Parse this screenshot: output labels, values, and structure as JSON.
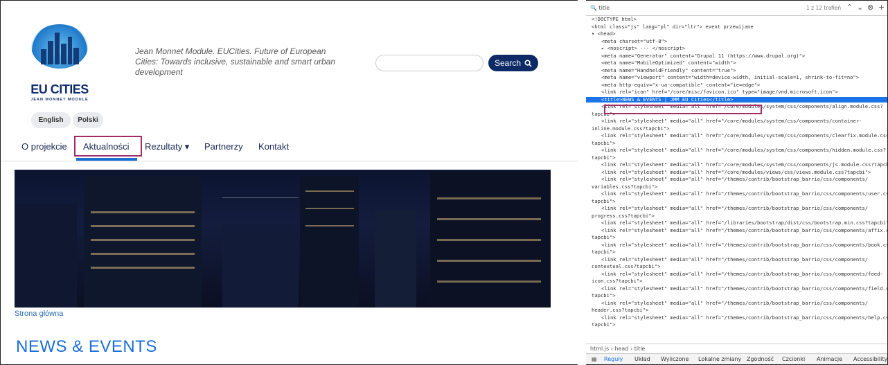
{
  "site": {
    "logo_title": "EU CITIES",
    "logo_subtitle": "JEAN MONNET MODULE",
    "tagline": "Jean Monnet Module. EUCities. Future of European Cities: Towards inclusive, sustainable and smart urban development",
    "search_placeholder": "",
    "search_button": "Search",
    "languages": [
      "English",
      "Polski"
    ],
    "nav": [
      "O projekcie",
      "Aktualności",
      "Rezultaty ▾",
      "Partnerzy",
      "Kontakt"
    ],
    "active_nav": "Aktualności",
    "breadcrumb": "Strona główna",
    "page_title": "NEWS & EVENTS",
    "colors": {
      "brand": "#0d2a66",
      "accent": "#1b6fd8",
      "highlight_box": "#a02a6a"
    }
  },
  "devtools": {
    "search_query": "title",
    "match_count": "1 z 12 trafień",
    "lines": [
      "<!DOCTYPE html>",
      "<html class=\"js\" lang=\"pl\" dir=\"ltr\"> event przewijane",
      "▾ <head>",
      "<meta charset=\"utf-8\">",
      "▸ <noscript> ··· </noscript>",
      "<meta name=\"Generator\" content=\"Drupal 11 (https://www.drupal.org)\">",
      "<meta name=\"MobileOptimized\" content=\"width\">",
      "<meta name=\"HandheldFriendly\" content=\"true\">",
      "<meta name=\"viewport\" content=\"width=device-width, initial-scale=1, shrink-to-fit=no\">",
      "<meta http-equiv=\"x-ua-compatible\" content=\"ie=edge\">",
      "<link rel=\"icon\" href=\"/core/misc/favicon.ico\" type=\"image/vnd.microsoft.icon\">",
      "<title>NEWS & EVENTS | JMM EU Cities</title>",
      "<link rel=\"stylesheet\" media=\"all\" href=\"/core/modules/system/css/components/align.module.css?",
      "tapcbi\">",
      "<link rel=\"stylesheet\" media=\"all\" href=\"/core/modules/system/css/components/container-",
      "inline.module.css?tapcbi\">",
      "<link rel=\"stylesheet\" media=\"all\" href=\"/core/modules/system/css/components/clearfix.module.css",
      "tapcbi\">",
      "<link rel=\"stylesheet\" media=\"all\" href=\"/core/modules/system/css/components/hidden.module.css?",
      "tapcbi\">",
      "<link rel=\"stylesheet\" media=\"all\" href=\"/core/modules/system/css/components/js.module.css?tapcb",
      "<link rel=\"stylesheet\" media=\"all\" href=\"/core/modules/views/css/views.module.css?tapcbi\">",
      "<link rel=\"stylesheet\" media=\"all\" href=\"/themes/contrib/bootstrap_barrio/css/components/",
      "variables.css?tapcbi\">",
      "<link rel=\"stylesheet\" media=\"all\" href=\"/themes/contrib/bootstrap_barrio/css/components/user.cs",
      "tapcbi\">",
      "<link rel=\"stylesheet\" media=\"all\" href=\"/themes/contrib/bootstrap_barrio/css/components/",
      "progress.css?tapcbi\">",
      "<link rel=\"stylesheet\" media=\"all\" href=\"/libraries/bootstrap/dist/css/bootstrap.min.css?tapcbi\"",
      "<link rel=\"stylesheet\" media=\"all\" href=\"/themes/contrib/bootstrap_barrio/css/components/affix.c",
      "tapcbi\">",
      "<link rel=\"stylesheet\" media=\"all\" href=\"/themes/contrib/bootstrap_barrio/css/components/book.cs",
      "tapcbi\">",
      "<link rel=\"stylesheet\" media=\"all\" href=\"/themes/contrib/bootstrap_barrio/css/components/",
      "contextual.css?tapcbi\">",
      "<link rel=\"stylesheet\" media=\"all\" href=\"/themes/contrib/bootstrap_barrio/css/components/feed-",
      "icon.css?tapcbi\">",
      "<link rel=\"stylesheet\" media=\"all\" href=\"/themes/contrib/bootstrap_barrio/css/components/field.c",
      "tapcbi\">",
      "<link rel=\"stylesheet\" media=\"all\" href=\"/themes/contrib/bootstrap_barrio/css/components/",
      "header.css?tapcbi\">",
      "<link rel=\"stylesheet\" media=\"all\" href=\"/themes/contrib/bootstrap_barrio/css/components/help.cs",
      "tapcbi\">"
    ],
    "selected_line": 11,
    "breadcrumb": "html.js › head › title",
    "tabs": [
      "Reguły",
      "Układ",
      "Wyliczone",
      "Lokalne zmiany",
      "Zgodność",
      "Czcionki",
      "Animacje",
      "Accessibility Ch"
    ]
  }
}
